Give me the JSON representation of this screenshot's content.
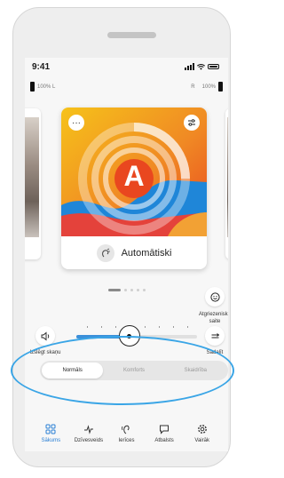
{
  "status_bar": {
    "time": "9:41"
  },
  "hearing_aids": {
    "left": {
      "battery_text": "100% L",
      "level": 1.0
    },
    "right": {
      "side_letter": "R",
      "battery_text": "100%",
      "level": 1.0
    }
  },
  "program_card": {
    "letter": "A",
    "name": "Automātiski",
    "more_icon": "ellipsis-icon",
    "settings_icon": "sliders-icon"
  },
  "pager": {
    "count": 5,
    "active": 0
  },
  "controls": {
    "mute_label": "Izslēgt skaņu",
    "return_label": "Atgriezeniskā saite",
    "split_label": "Sadalīt",
    "volume_fraction": 0.44
  },
  "sound_modes": {
    "options": [
      "Normāls",
      "Komforts",
      "Skaidrība"
    ],
    "selected": "Normāls"
  },
  "tabs": [
    {
      "label": "Sākums",
      "icon": "grid-icon",
      "active": true
    },
    {
      "label": "Dzīvesveids",
      "icon": "pulse-icon",
      "active": false
    },
    {
      "label": "Ierīces",
      "icon": "hearing-aid-icon",
      "active": false
    },
    {
      "label": "Atbalsts",
      "icon": "chat-icon",
      "active": false
    },
    {
      "label": "Vairāk",
      "icon": "gear-icon",
      "active": false
    }
  ],
  "colors": {
    "accent": "#2a7fd4",
    "highlight_ellipse": "#3aa5e6",
    "art_orange": "#f08a24",
    "art_blue": "#1f86d8"
  }
}
